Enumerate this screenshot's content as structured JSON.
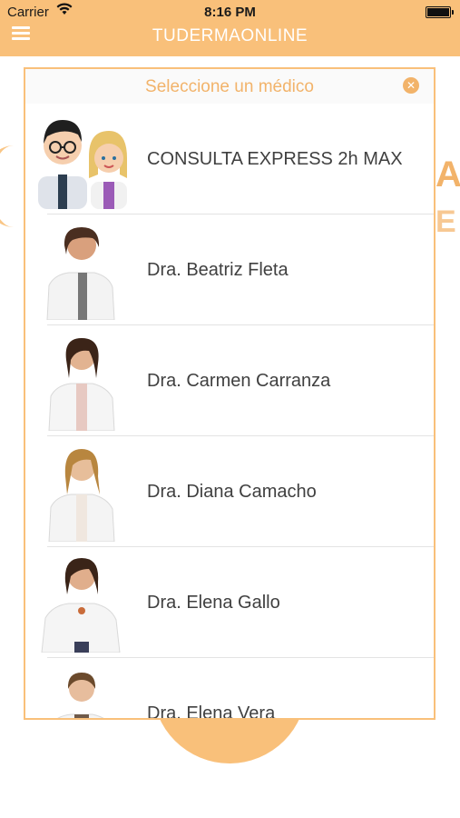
{
  "status_bar": {
    "carrier": "Carrier",
    "time": "8:16 PM"
  },
  "nav": {
    "title": "TUDERMAONLINE"
  },
  "modal": {
    "title": "Seleccione un médico",
    "doctors": [
      {
        "label": "CONSULTA EXPRESS 2h MAX"
      },
      {
        "label": "Dra. Beatriz Fleta"
      },
      {
        "label": "Dra. Carmen Carranza"
      },
      {
        "label": "Dra. Diana Camacho"
      },
      {
        "label": "Dra. Elena Gallo"
      },
      {
        "label": "Dra. Elena Vera"
      }
    ]
  },
  "colors": {
    "accent": "#f9c07a",
    "title_text": "#f2b36a",
    "list_text": "#404040"
  }
}
